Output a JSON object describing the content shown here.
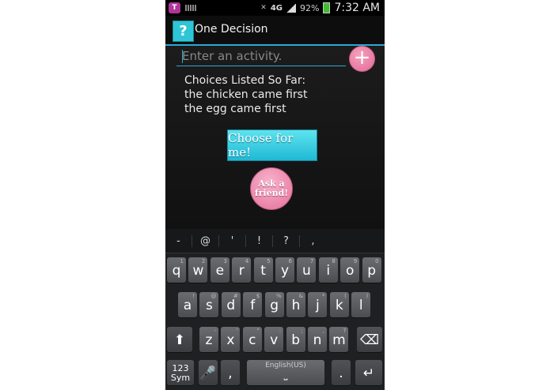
{
  "status_bar": {
    "network": "4G",
    "battery": "92%",
    "time": "7:32 AM"
  },
  "app": {
    "icon_glyph": "?",
    "title": "One Decision"
  },
  "activity_input": {
    "placeholder": "Enter an activity.",
    "value": ""
  },
  "add_button": {
    "label": "+"
  },
  "choices": {
    "header": "Choices Listed So Far:",
    "items": [
      "the chicken came first",
      "the egg came first"
    ]
  },
  "choose_button": {
    "label": "Choose for me!"
  },
  "ask_button": {
    "line1": "Ask a",
    "line2": "friend!"
  },
  "keyboard": {
    "suggestions": [
      "-",
      "@",
      "'",
      "!",
      "?",
      ","
    ],
    "row1": [
      {
        "k": "q",
        "a": "1"
      },
      {
        "k": "w",
        "a": "2"
      },
      {
        "k": "e",
        "a": "3"
      },
      {
        "k": "r",
        "a": "4"
      },
      {
        "k": "t",
        "a": "5"
      },
      {
        "k": "y",
        "a": "6"
      },
      {
        "k": "u",
        "a": "7"
      },
      {
        "k": "i",
        "a": "8"
      },
      {
        "k": "o",
        "a": "9"
      },
      {
        "k": "p",
        "a": "0"
      }
    ],
    "row2": [
      {
        "k": "a",
        "a": "!"
      },
      {
        "k": "s",
        "a": "@"
      },
      {
        "k": "d",
        "a": "#"
      },
      {
        "k": "f",
        "a": "$"
      },
      {
        "k": "g",
        "a": "%"
      },
      {
        "k": "h",
        "a": "&"
      },
      {
        "k": "j",
        "a": "*"
      },
      {
        "k": "k",
        "a": "("
      },
      {
        "k": "l",
        "a": ")"
      }
    ],
    "row3": [
      {
        "k": "z",
        "a": "-"
      },
      {
        "k": "x",
        "a": "'"
      },
      {
        "k": "c",
        "a": "\""
      },
      {
        "k": "v",
        "a": ":"
      },
      {
        "k": "b",
        "a": ";"
      },
      {
        "k": "n",
        "a": ","
      },
      {
        "k": "m",
        "a": "?"
      }
    ],
    "sym_top": "123",
    "sym_bottom": "Sym",
    "comma": ",",
    "space_label": "English(US)",
    "period": "."
  },
  "colors": {
    "accent": "#2aa8d6",
    "choose_button": "#3fd0e2",
    "ask_button": "#ef89ad"
  }
}
